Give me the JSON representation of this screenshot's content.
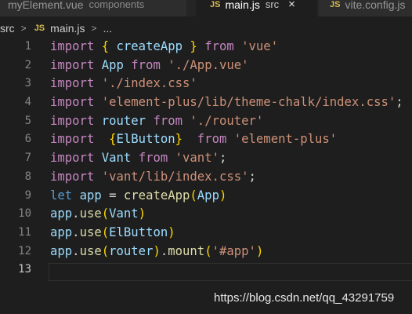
{
  "tabs": [
    {
      "label": "myElement.vue",
      "description": "components",
      "active": false
    },
    {
      "label": "main.js",
      "description": "src",
      "active": true,
      "close": "×"
    },
    {
      "label": "vite.config.js",
      "description": "",
      "active": false
    }
  ],
  "file_badge": "JS",
  "breadcrumb": {
    "folder": "src",
    "separator": ">",
    "file": "main.js",
    "symbol": "..."
  },
  "line_numbers": [
    "1",
    "2",
    "3",
    "4",
    "5",
    "6",
    "7",
    "8",
    "9",
    "10",
    "11",
    "12",
    "13"
  ],
  "code": {
    "kw_import": "import",
    "kw_from": "from",
    "kw_let": "let",
    "app": "app",
    "App": "App",
    "createApp": "createApp",
    "router": "router",
    "Vant": "Vant",
    "ElButton": "ElButton",
    "use": "use",
    "mount": "mount",
    "s_vue": "'vue'",
    "s_appvue": "'./App.vue'",
    "s_indexcss": "'./index.css'",
    "s_elementcss": "'element-plus/lib/theme-chalk/index.css'",
    "s_router": "'./router'",
    "s_elementplus": "'element-plus'",
    "s_vant": "'vant'",
    "s_vantcss": "'vant/lib/index.css'",
    "s_app": "'#app'"
  },
  "watermark": "https://blog.csdn.net/qq_43291759",
  "colors": {
    "keyword": "#569cd6",
    "control": "#c586c0",
    "string": "#ce9178",
    "variable": "#9cdcfe",
    "function": "#dcdcaa",
    "background": "#1e1e1e"
  }
}
